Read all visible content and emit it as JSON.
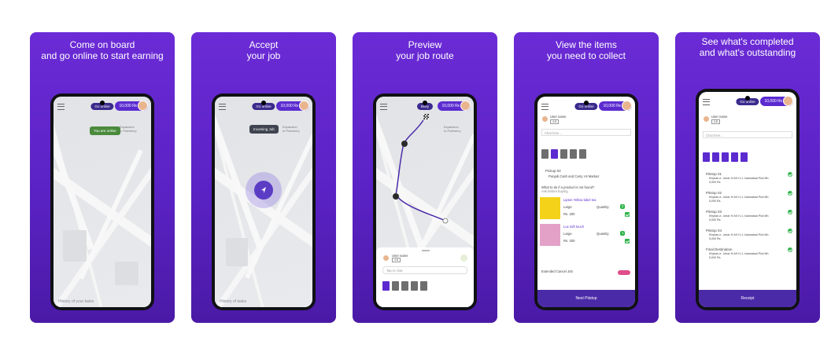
{
  "cards": [
    {
      "caption": [
        "Come on board",
        "and go online to start earning"
      ],
      "status": "Go online",
      "balance": "10,000 ₨",
      "chip": "You are online",
      "map_label": [
        "Expansion",
        "to Poleberry"
      ],
      "bottom_link": "History of your tasks"
    },
    {
      "caption": [
        "Accept",
        "your job"
      ],
      "status": "Go online",
      "balance": "10,000 ₨",
      "chip": "Incoming Job",
      "map_label": [
        "Expansion",
        "to Poleberry"
      ],
      "bottom_link": "History of tasks"
    },
    {
      "caption": [
        "Preview",
        "your job route"
      ],
      "status": "Busy",
      "balance": "10,000 ₨",
      "map_label": [
        "Expansion",
        "to Poleberry"
      ],
      "user_name": "User name",
      "rating": "4.8",
      "search_placeholder": "Tap to chat"
    },
    {
      "caption": [
        "View the items",
        "you need to collect"
      ],
      "status": "Go online",
      "balance": "10,000 ₨",
      "user_name": "User name",
      "rating": "4.8",
      "chat_placeholder": "Chat here...",
      "pickup_title": "Pickup 02",
      "pickup_addr": "Punjab Cash and Carry I-8 Markaz",
      "question": "What to do if a product is not found?",
      "question_sub": "Ask before buying",
      "items": [
        {
          "name": "Lipton Yellow label tea",
          "size": "Large",
          "qty_label": "Quantity",
          "qty": "2",
          "price": "Rs. 200"
        },
        {
          "name": "Lux soft touch",
          "size": "Large",
          "qty_label": "Quantity",
          "qty": "1",
          "price": "Rs. 200"
        }
      ],
      "footer_text": "Extended Cancel Job",
      "button": "Next Pitstop"
    },
    {
      "caption": [
        "See what's completed",
        "and what's outstanding"
      ],
      "status": "Go online",
      "balance": "10,000 ₨",
      "user_name": "User name",
      "rating": "4.8",
      "chat_placeholder": "Chat here...",
      "stops": [
        {
          "title": "Pitstop 01",
          "addr": "Khyban-e- Johar H-9/4 H-1, Islamabad Pick 5th",
          "extra": "5,000 Rs."
        },
        {
          "title": "Pitstop 02",
          "addr": "Khyban-e- Johar H-9/4 H-1, Islamabad Pick 5th",
          "extra": "5,000 Rs."
        },
        {
          "title": "Pitstop 03",
          "addr": "Khyban-e- Johar H-9/4 H-1, Islamabad Pick 5th",
          "extra": "5,000 Rs."
        },
        {
          "title": "Pitstop 04",
          "addr": "Khyban-e- Johar H-9/4 H-1, Islamabad Pick 5th",
          "extra": "5,000 Rs."
        },
        {
          "title": "Final Destination",
          "addr": "Khyban-e- Johar H-9/4 H-1, Islamabad Pick 5th",
          "extra": "5,000 Rs."
        }
      ],
      "button": "Receipt"
    }
  ],
  "colors": {
    "brand_purple": "#5b2bd0",
    "online_green": "#4a8a3c",
    "check_green": "#2fb34a"
  }
}
